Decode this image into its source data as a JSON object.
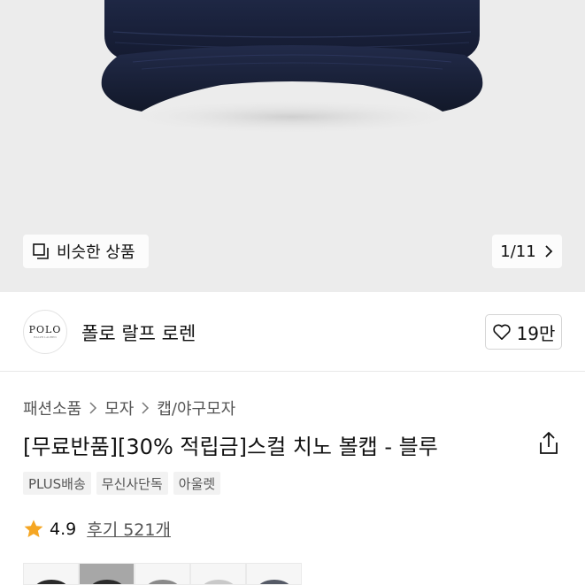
{
  "gallery": {
    "similar_label": "비슷한 상품",
    "page_indicator": "1/11"
  },
  "brand": {
    "logo_text": "POLO",
    "logo_sub": "RALPH LAUREN",
    "name": "폴로 랄프 로렌",
    "likes": "19만"
  },
  "breadcrumb": [
    "패션소품",
    "모자",
    "캡/야구모자"
  ],
  "product": {
    "title": "[무료반품][30% 적립금]스컬 치노 볼캡 - 블루"
  },
  "badges": [
    "PLUS배송",
    "무신사단독",
    "아울렛"
  ],
  "rating": {
    "score": "4.9",
    "reviews": "후기 521개"
  },
  "colors": {
    "cap_navy": "#1c2440",
    "star": "#f5a623",
    "hero_bg": "#ececec"
  },
  "thumbnails": [
    {
      "color": "#2a2a2a"
    },
    {
      "color": "#2b2b2b",
      "active": true
    },
    {
      "color": "#8a8a8a"
    },
    {
      "color": "#c9c9c9"
    },
    {
      "color": "#555a66"
    }
  ]
}
